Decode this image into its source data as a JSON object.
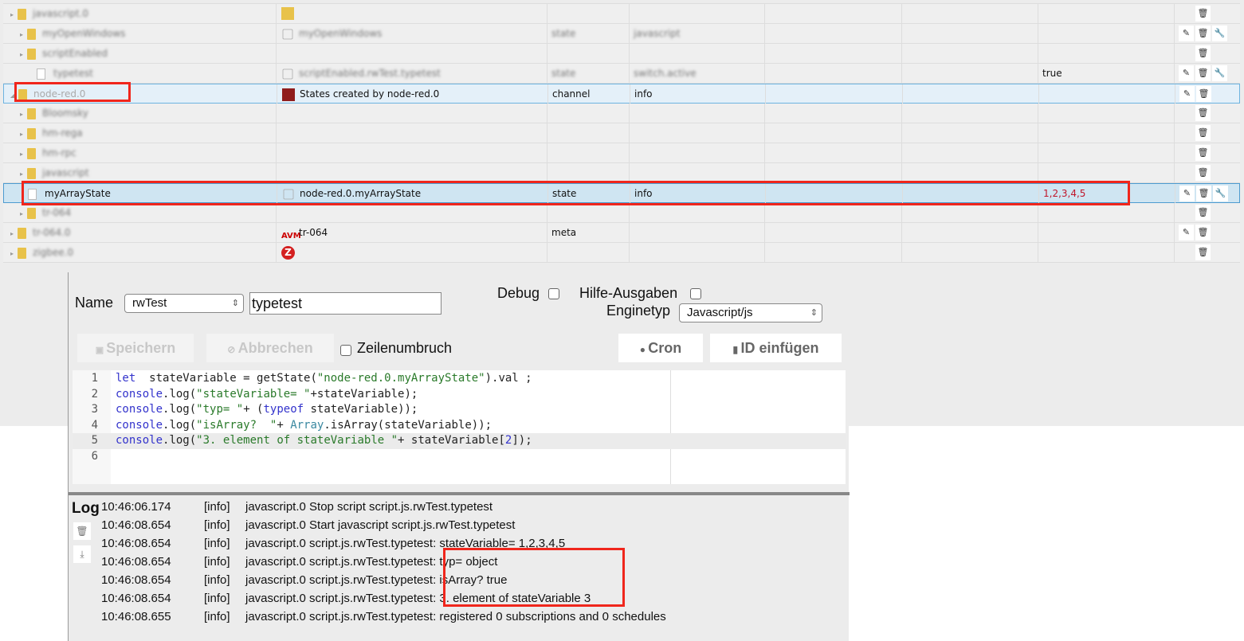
{
  "tree": {
    "rows": [
      {
        "name": "javascript.0",
        "title": "",
        "type": "",
        "role": "",
        "value": "",
        "buttons": [
          "delete"
        ],
        "blurred": true,
        "indent": 0,
        "icon": "folder"
      },
      {
        "name": "myOpenWindows",
        "title": "myOpenWindows",
        "type": "state",
        "role": "javascript",
        "value": "",
        "buttons": [
          "edit",
          "delete",
          "settings"
        ],
        "blurred": true,
        "indent": 1,
        "icon": "folder"
      },
      {
        "name": "scriptEnabled",
        "title": "",
        "type": "",
        "role": "",
        "value": "",
        "buttons": [
          "delete"
        ],
        "blurred": true,
        "indent": 1,
        "icon": "folder"
      },
      {
        "name": "typetest",
        "title": "scriptEnabled.rwTest.typetest",
        "type": "state",
        "role": "switch.active",
        "value": "true",
        "buttons": [
          "edit",
          "delete",
          "settings"
        ],
        "blurred": true,
        "indent": 2,
        "icon": "file"
      },
      {
        "name": "node-red.0",
        "title": "States created by node-red.0",
        "type": "channel",
        "role": "info",
        "value": "",
        "buttons": [
          "edit",
          "delete"
        ],
        "blurred": false,
        "indent": 0,
        "icon": "folder"
      },
      {
        "name": "Bloomsky",
        "title": "",
        "type": "",
        "role": "",
        "value": "",
        "buttons": [
          "delete"
        ],
        "blurred": true,
        "indent": 1,
        "icon": "folder"
      },
      {
        "name": "hm-rega",
        "title": "",
        "type": "",
        "role": "",
        "value": "",
        "buttons": [
          "delete"
        ],
        "blurred": true,
        "indent": 1,
        "icon": "folder"
      },
      {
        "name": "hm-rpc",
        "title": "",
        "type": "",
        "role": "",
        "value": "",
        "buttons": [
          "delete"
        ],
        "blurred": true,
        "indent": 1,
        "icon": "folder"
      },
      {
        "name": "javascript",
        "title": "",
        "type": "",
        "role": "",
        "value": "",
        "buttons": [
          "delete"
        ],
        "blurred": true,
        "indent": 1,
        "icon": "folder"
      },
      {
        "name": "myArrayState",
        "title": "node-red.0.myArrayState",
        "type": "state",
        "role": "info",
        "value": "1,2,3,4,5",
        "buttons": [
          "edit",
          "delete",
          "settings"
        ],
        "blurred": false,
        "indent": 1,
        "icon": "file"
      },
      {
        "name": "tr-064",
        "title": "",
        "type": "",
        "role": "",
        "value": "",
        "buttons": [
          "delete"
        ],
        "blurred": true,
        "indent": 1,
        "icon": "folder"
      },
      {
        "name": "tr-064.0",
        "title": "tr-064",
        "type": "meta",
        "role": "",
        "value": "",
        "buttons": [
          "edit",
          "delete"
        ],
        "blurred": true,
        "indent": 0,
        "icon": "folder"
      },
      {
        "name": "zigbee.0",
        "title": "",
        "type": "",
        "role": "",
        "value": "",
        "buttons": [
          "delete"
        ],
        "blurred": true,
        "indent": 0,
        "icon": "folder"
      }
    ]
  },
  "editor": {
    "name_label": "Name",
    "folder": "rwTest",
    "script_name": "typetest",
    "debug_label": "Debug",
    "help_label": "Hilfe-Ausgaben",
    "engine_label": "Enginetyp",
    "engine": "Javascript/js",
    "save": "Speichern",
    "cancel": "Abbrechen",
    "wrap": "Zeilenumbruch",
    "cron": "Cron",
    "insert_id": "ID einfügen",
    "code": [
      [
        [
          "kw",
          "let"
        ],
        [
          "",
          "  stateVariable = getState("
        ],
        [
          "st",
          "\"node-red.0.myArrayState\""
        ],
        [
          "",
          ").val ;"
        ]
      ],
      [
        [
          "kw",
          "console"
        ],
        [
          "",
          ".log("
        ],
        [
          "st",
          "\"stateVariable= \""
        ],
        [
          "",
          "+stateVariable);"
        ]
      ],
      [
        [
          "kw",
          "console"
        ],
        [
          "",
          ".log("
        ],
        [
          "st",
          "\"typ= \""
        ],
        [
          "",
          "+ ("
        ],
        [
          "kw",
          "typeof"
        ],
        [
          "",
          " stateVariable));"
        ]
      ],
      [
        [
          "kw",
          "console"
        ],
        [
          "",
          ".log("
        ],
        [
          "st",
          "\"isArray?  \""
        ],
        [
          "",
          "+ "
        ],
        [
          "bl",
          "Array"
        ],
        [
          "",
          ".isArray(stateVariable));"
        ]
      ],
      [
        [
          "kw",
          "console"
        ],
        [
          "",
          ".log("
        ],
        [
          "st",
          "\"3. element of stateVariable \""
        ],
        [
          "",
          "+ stateVariable["
        ],
        [
          "kw",
          "2"
        ],
        [
          "",
          "]);"
        ]
      ],
      []
    ]
  },
  "log": {
    "label": "Log",
    "entries": [
      {
        "time": "10:46:06.174",
        "level": "[info]",
        "msg": "javascript.0 Stop script script.js.rwTest.typetest"
      },
      {
        "time": "10:46:08.654",
        "level": "[info]",
        "msg": "javascript.0 Start javascript script.js.rwTest.typetest"
      },
      {
        "time": "10:46:08.654",
        "level": "[info]",
        "msg": "javascript.0 script.js.rwTest.typetest: stateVariable= 1,2,3,4,5"
      },
      {
        "time": "10:46:08.654",
        "level": "[info]",
        "msg": "javascript.0 script.js.rwTest.typetest: typ= object"
      },
      {
        "time": "10:46:08.654",
        "level": "[info]",
        "msg": "javascript.0 script.js.rwTest.typetest: isArray? true"
      },
      {
        "time": "10:46:08.654",
        "level": "[info]",
        "msg": "javascript.0 script.js.rwTest.typetest: 3. element of stateVariable 3"
      },
      {
        "time": "10:46:08.655",
        "level": "[info]",
        "msg": "javascript.0 script.js.rwTest.typetest: registered 0 subscriptions and 0 schedules"
      }
    ]
  },
  "colors": {
    "highlight": "#f0261c",
    "value_red": "#c0152a",
    "selection": "#cfe5f2"
  }
}
